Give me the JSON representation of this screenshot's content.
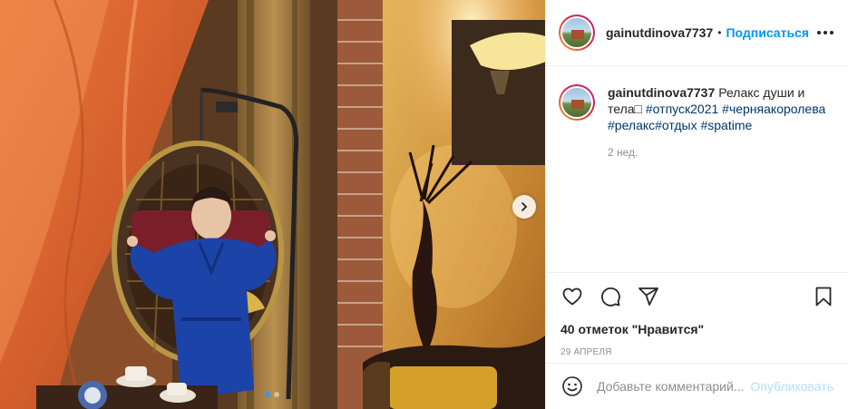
{
  "post": {
    "username": "gainutdinova7737",
    "separator": "•",
    "follow_label": "Подписаться",
    "caption_user": "gainutdinova7737",
    "caption_text": "Релакс души и тела□",
    "hashtags": [
      "#отпуск2021",
      "#черняакоролева",
      "#релакс",
      "#отдых",
      "#spatime"
    ],
    "time_ago": "2 нед.",
    "likes": "40 отметок \"Нравится\"",
    "date": "29 АПРЕЛЯ"
  },
  "comment": {
    "placeholder": "Добавьте комментарий...",
    "publish_label": "Опубликовать"
  },
  "carousel": {
    "slide_count": 2,
    "active_index": 0
  },
  "icons": {
    "like": "heart-icon",
    "comment": "comment-icon",
    "share": "share-icon",
    "save": "bookmark-icon",
    "more": "more-icon",
    "emoji": "emoji-icon",
    "next": "chevron-right-icon"
  },
  "colors": {
    "follow": "#0095f6",
    "hashtag": "#00376b",
    "publish_disabled": "#b2dffc",
    "carousel_active": "#3897f0"
  }
}
